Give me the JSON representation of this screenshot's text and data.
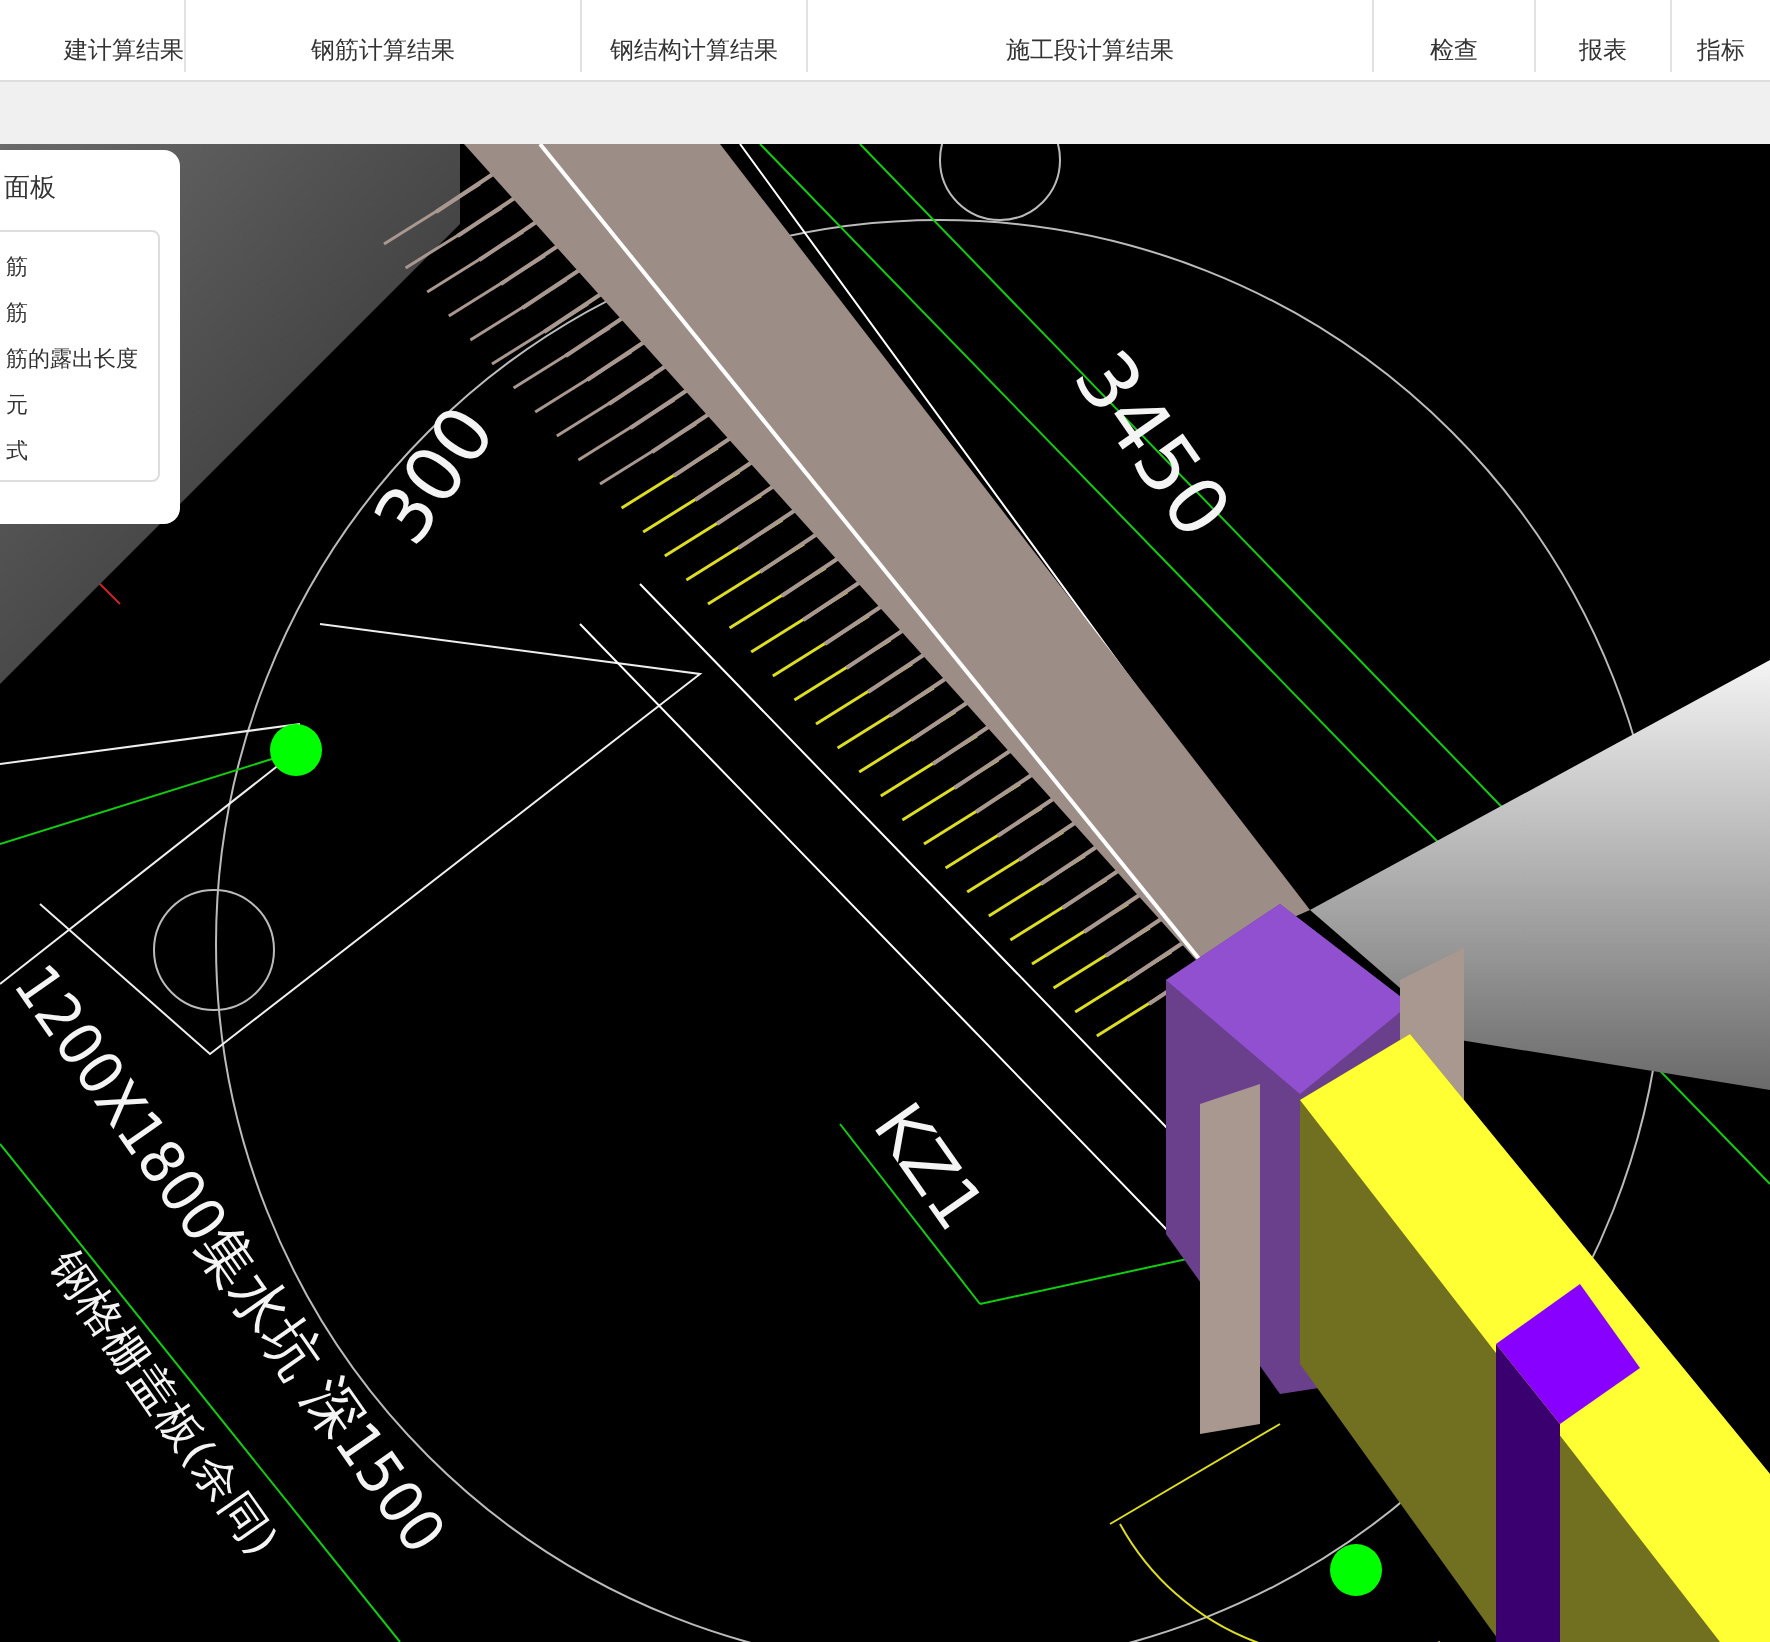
{
  "tabs": [
    {
      "label": "建计算结果"
    },
    {
      "label": "钢筋计算结果"
    },
    {
      "label": "钢结构计算结果"
    },
    {
      "label": "施工段计算结果"
    },
    {
      "label": "检查"
    },
    {
      "label": "报表"
    },
    {
      "label": "指标"
    }
  ],
  "panel": {
    "title": "面板",
    "items": [
      "筋",
      "筋",
      "筋的露出长度",
      "元",
      "式"
    ]
  },
  "view_labels": [
    {
      "kind": "dimension",
      "text": "3450"
    },
    {
      "kind": "dimension-left",
      "text": "300"
    },
    {
      "kind": "tag",
      "text": "KZ1"
    },
    {
      "kind": "note",
      "text": "1200X1800集水坑 深1500"
    },
    {
      "kind": "note2",
      "text": "钢格栅盖板(余同)"
    }
  ]
}
